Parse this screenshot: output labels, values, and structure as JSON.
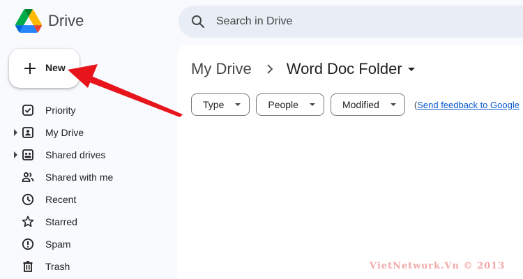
{
  "app": {
    "brand": "Drive"
  },
  "search": {
    "placeholder": "Search in Drive"
  },
  "new_button": {
    "label": "New"
  },
  "sidebar": {
    "items": [
      {
        "label": "Priority",
        "icon": "priority-icon",
        "expandable": false
      },
      {
        "label": "My Drive",
        "icon": "my-drive-icon",
        "expandable": true
      },
      {
        "label": "Shared drives",
        "icon": "shared-drives-icon",
        "expandable": true
      },
      {
        "label": "Shared with me",
        "icon": "shared-with-me-icon",
        "expandable": false
      },
      {
        "label": "Recent",
        "icon": "clock-icon",
        "expandable": false
      },
      {
        "label": "Starred",
        "icon": "star-icon",
        "expandable": false
      },
      {
        "label": "Spam",
        "icon": "spam-icon",
        "expandable": false
      },
      {
        "label": "Trash",
        "icon": "trash-icon",
        "expandable": false
      }
    ]
  },
  "breadcrumb": {
    "root": "My Drive",
    "current": "Word Doc Folder"
  },
  "filters": {
    "chips": [
      {
        "label": "Type"
      },
      {
        "label": "People"
      },
      {
        "label": "Modified"
      }
    ],
    "feedback_open": "(",
    "feedback_link": "Send feedback to Google"
  },
  "annotation": {
    "arrow_color": "#e8141c"
  },
  "watermark": {
    "text": "VietNetwork.Vn © 2013"
  },
  "colors": {
    "background": "#f8fafd",
    "search_bg": "#e9eef6",
    "link": "#0b57d0"
  }
}
